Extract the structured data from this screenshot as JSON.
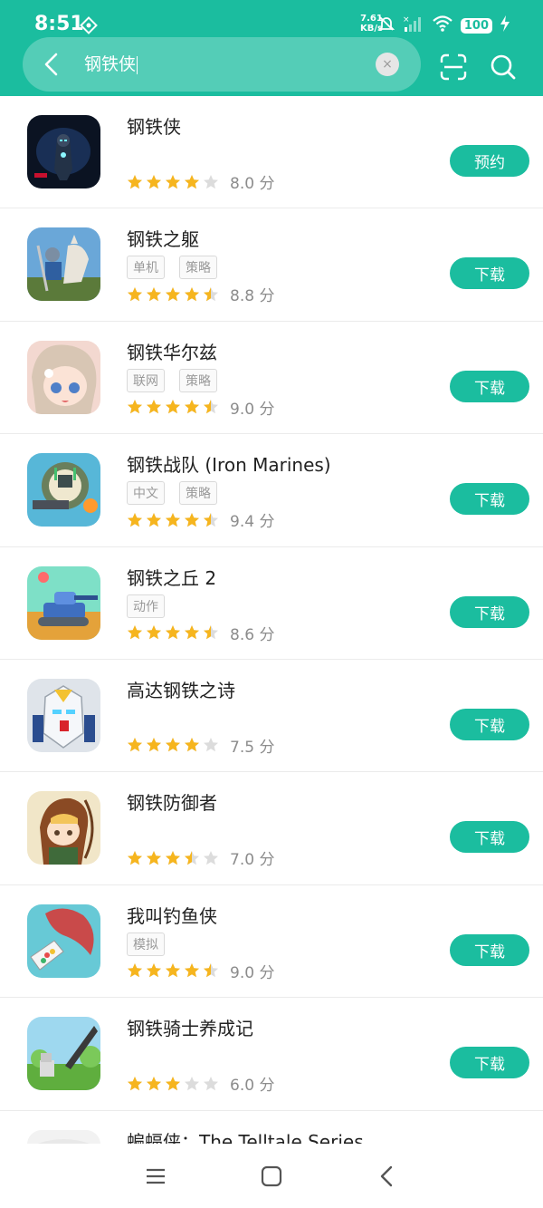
{
  "status_bar": {
    "time": "8:51",
    "net_speed_value": "7.61",
    "net_speed_unit": "KB/s",
    "battery": "100"
  },
  "search": {
    "query": "钢铁侠",
    "clear_label": "×"
  },
  "colors": {
    "accent": "#1bbd9f",
    "star_on": "#f6b51e",
    "star_off": "#dcdcdc"
  },
  "apps": [
    {
      "name": "钢铁侠",
      "tags": [],
      "stars": 4,
      "score": "8.0 分",
      "action": "预约"
    },
    {
      "name": "钢铁之躯",
      "tags": [
        "单机",
        "策略"
      ],
      "stars": 4.5,
      "score": "8.8 分",
      "action": "下载"
    },
    {
      "name": "钢铁华尔兹",
      "tags": [
        "联网",
        "策略"
      ],
      "stars": 4.5,
      "score": "9.0 分",
      "action": "下载"
    },
    {
      "name": "钢铁战队 (Iron Marines)",
      "tags": [
        "中文",
        "策略"
      ],
      "stars": 4.5,
      "score": "9.4 分",
      "action": "下载"
    },
    {
      "name": "钢铁之丘 2",
      "tags": [
        "动作"
      ],
      "stars": 4.5,
      "score": "8.6 分",
      "action": "下载"
    },
    {
      "name": "高达钢铁之诗",
      "tags": [],
      "stars": 4,
      "score": "7.5 分",
      "action": "下载"
    },
    {
      "name": "钢铁防御者",
      "tags": [],
      "stars": 3.5,
      "score": "7.0 分",
      "action": "下载"
    },
    {
      "name": "我叫钓鱼侠",
      "tags": [
        "模拟"
      ],
      "stars": 4.5,
      "score": "9.0 分",
      "action": "下载"
    },
    {
      "name": "钢铁骑士养成记",
      "tags": [],
      "stars": 3,
      "score": "6.0 分",
      "action": "下载"
    },
    {
      "name": "蝙蝠侠：The Telltale Series",
      "tags": [],
      "stars": 0,
      "score": "",
      "action": ""
    }
  ]
}
